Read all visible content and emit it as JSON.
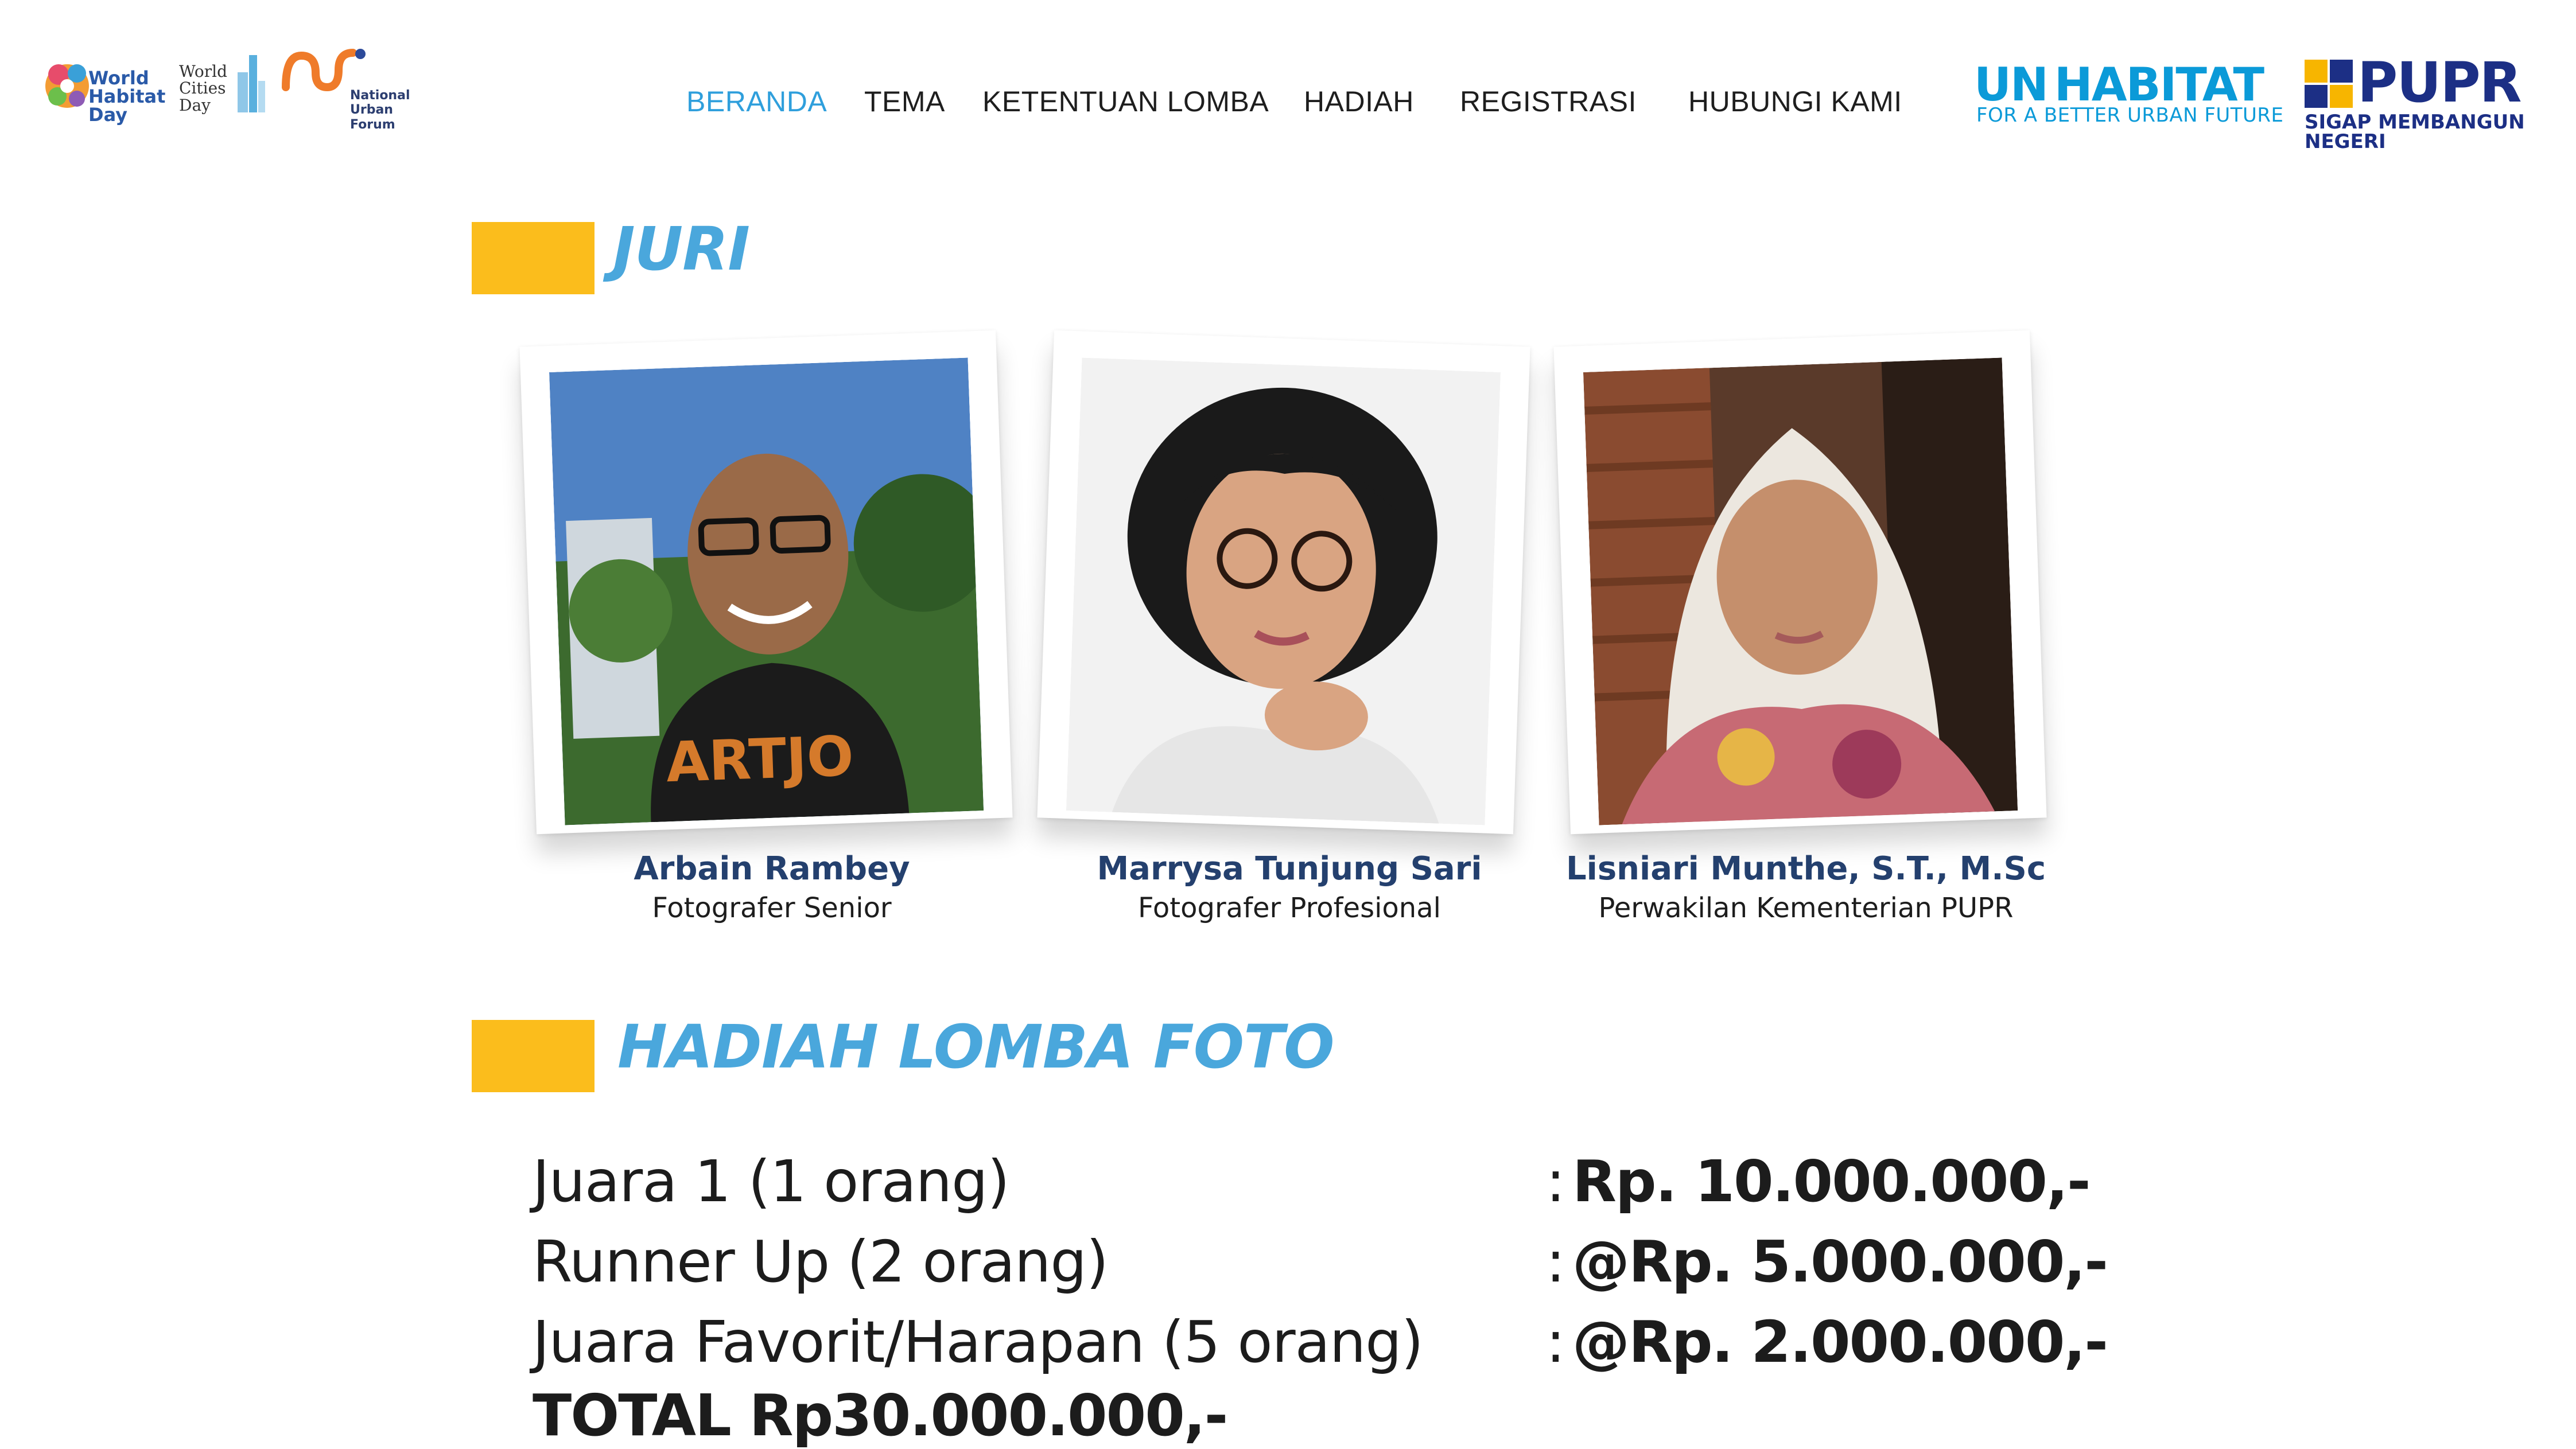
{
  "header": {
    "logos": {
      "world_habitat_day": "World Habitat Day",
      "world_cities_day": "World Cities Day",
      "national_urban_forum": "National Urban Forum",
      "un_habitat": "UN HABITAT",
      "un_habitat_tagline": "FOR A BETTER URBAN FUTURE",
      "pupr": "PUPR",
      "pupr_tagline": "SIGAP MEMBANGUN NEGERI"
    },
    "nav": [
      {
        "label": "BERANDA",
        "active": true
      },
      {
        "label": "TEMA",
        "active": false
      },
      {
        "label": "KETENTUAN LOMBA",
        "active": false
      },
      {
        "label": "HADIAH",
        "active": false
      },
      {
        "label": "REGISTRASI",
        "active": false
      },
      {
        "label": "HUBUNGI KAMI",
        "active": false
      }
    ]
  },
  "juri": {
    "title": "JURI",
    "members": [
      {
        "name": "Arbain Rambey",
        "role": "Fotografer Senior"
      },
      {
        "name": "Marrysa Tunjung Sari",
        "role": "Fotografer Profesional"
      },
      {
        "name": "Lisniari Munthe, S.T., M.Sc",
        "role": "Perwakilan Kementerian PUPR"
      }
    ]
  },
  "hadiah": {
    "title": "HADIAH LOMBA FOTO",
    "prizes": [
      {
        "label": "Juara 1 (1 orang)",
        "value": "Rp. 10.000.000,-"
      },
      {
        "label": "Runner Up (2 orang)",
        "value": "@Rp. 5.000.000,-"
      },
      {
        "label": "Juara Favorit/Harapan (5 orang)",
        "value": "@Rp. 2.000.000,-"
      }
    ],
    "separator": ":",
    "total": "TOTAL Rp30.000.000,-"
  },
  "colors": {
    "accent_blue": "#4aa7dc",
    "nav_active": "#2f9fdc",
    "section_bar": "#fbbd1c",
    "name_navy": "#24406e",
    "unhabitat_blue": "#0b9ad8",
    "pupr_navy": "#1c2f85",
    "pupr_yellow": "#f7b500"
  }
}
